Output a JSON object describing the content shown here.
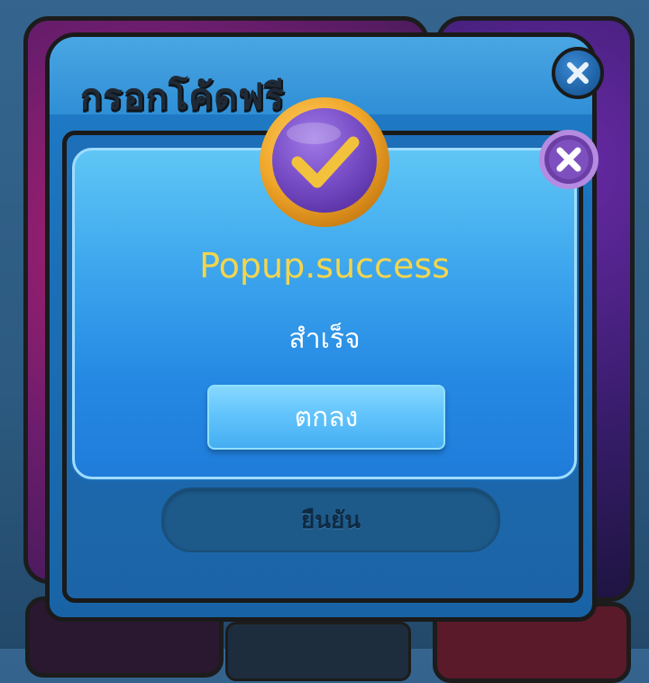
{
  "code_dialog": {
    "title": "กรอกโค้ดฟรี",
    "confirm_label": "ยืนยัน"
  },
  "success_popup": {
    "title": "Popup.success",
    "message": "สำเร็จ",
    "ok_label": "ตกลง"
  },
  "icons": {
    "success": "checkmark-icon",
    "close": "close-icon"
  },
  "colors": {
    "title_yellow": "#f3d54e",
    "popup_blue": "#3ea7ee",
    "badge_purple": "#7a4fc8",
    "badge_gold": "#f0a72a"
  }
}
